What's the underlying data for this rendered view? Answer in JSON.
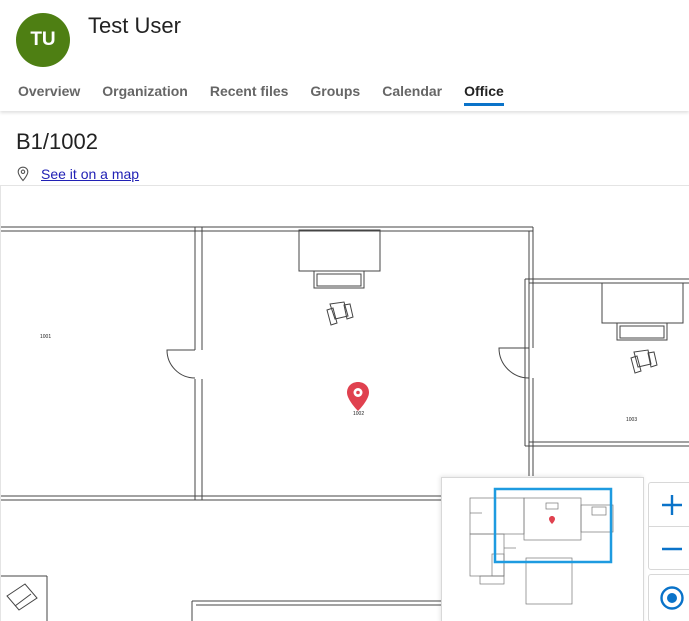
{
  "user": {
    "initials": "TU",
    "name": "Test User"
  },
  "tabs": [
    {
      "label": "Overview",
      "active": false
    },
    {
      "label": "Organization",
      "active": false
    },
    {
      "label": "Recent files",
      "active": false
    },
    {
      "label": "Groups",
      "active": false
    },
    {
      "label": "Calendar",
      "active": false
    },
    {
      "label": "Office",
      "active": true
    }
  ],
  "office": {
    "room": "B1/1002",
    "map_link": "See it on a map",
    "rooms": [
      "1001",
      "1002",
      "1003"
    ]
  },
  "colors": {
    "accent": "#0a73c9",
    "avatar": "#4e7f13",
    "pin": "#e0414f",
    "minimap_frame": "#1e9be0"
  },
  "icons": {
    "map_link": "location-pin-icon",
    "zoom_in": "plus-icon",
    "zoom_out": "minus-icon",
    "locate": "locate-target-icon"
  }
}
